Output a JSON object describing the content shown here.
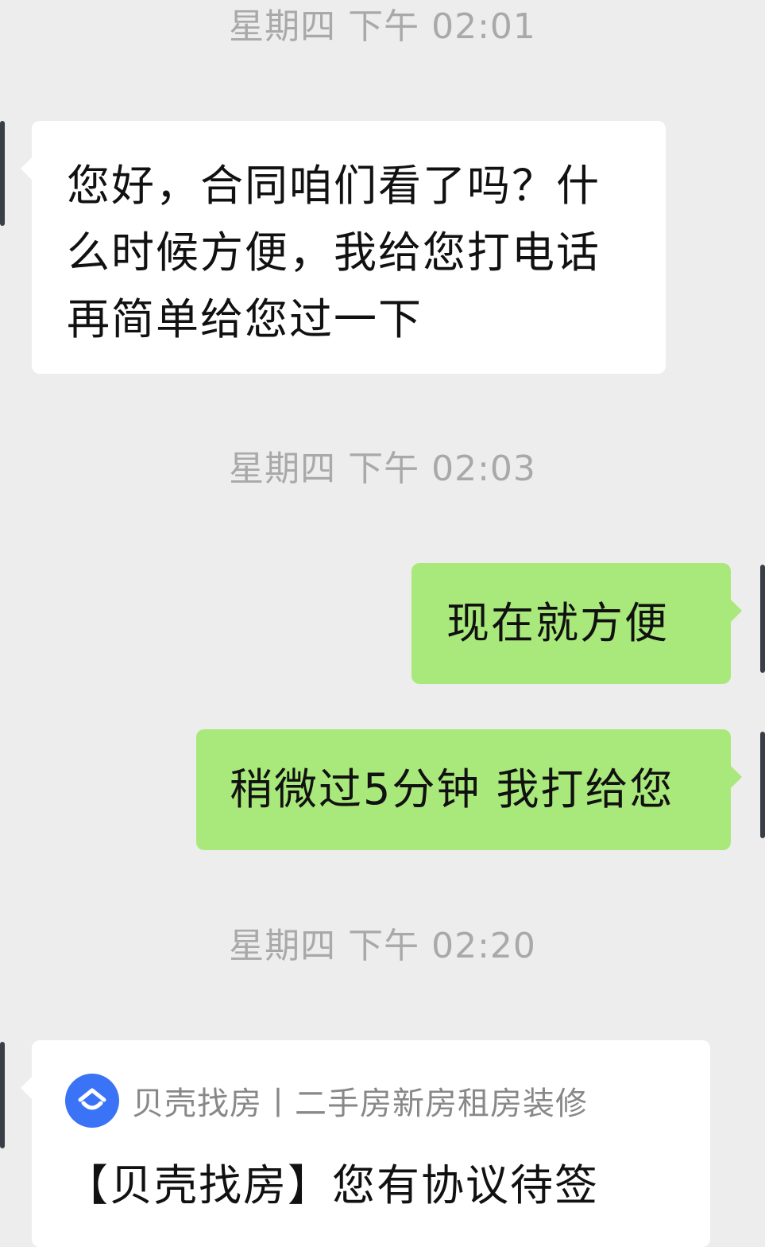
{
  "chat": {
    "timestamps": [
      "星期四 下午 02:01",
      "星期四 下午 02:03",
      "星期四 下午 02:20"
    ],
    "messages": [
      {
        "sender": "other",
        "text": "您好，合同咱们看了吗？什么时候方便，我给您打电话再简单给您过一下"
      },
      {
        "sender": "me",
        "text": "现在就方便"
      },
      {
        "sender": "me",
        "text": "稍微过5分钟 我打给您"
      }
    ],
    "card": {
      "icon": "beike-logo-icon",
      "source": "贝壳找房丨二手房新房租房装修",
      "title": "【贝壳找房】您有协议待签"
    }
  },
  "colors": {
    "background": "#ededed",
    "incoming_bubble": "#ffffff",
    "outgoing_bubble": "#a9e97b",
    "timestamp_text": "#a9a9a9",
    "brand_blue": "#3b73f6"
  }
}
